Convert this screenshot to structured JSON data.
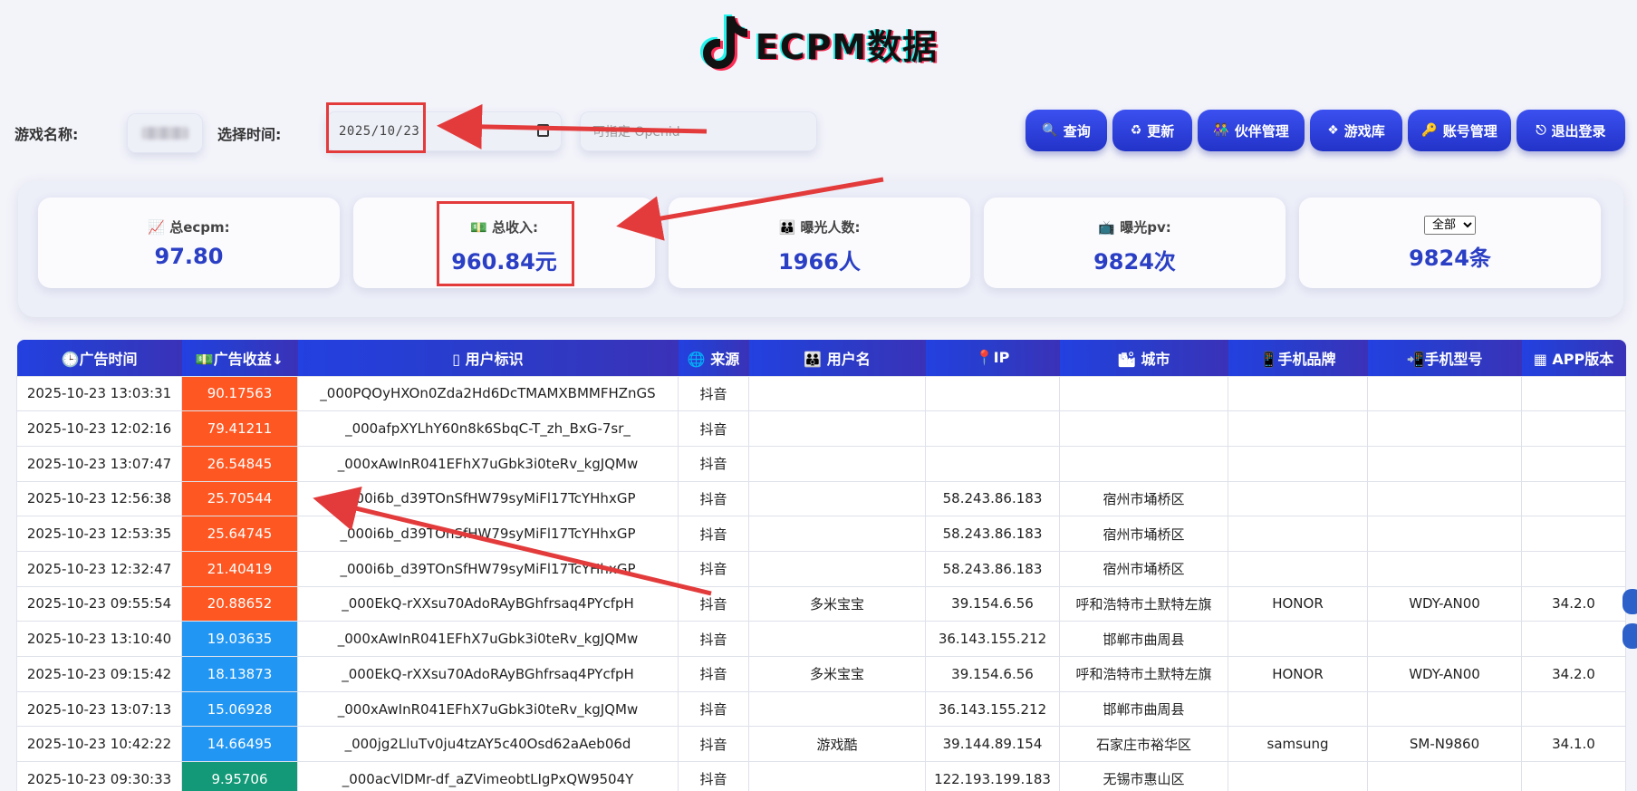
{
  "logo": {
    "text": "ECPM数据"
  },
  "filters": {
    "game_label": "游戏名称:",
    "time_label": "选择时间:",
    "date_value": "2025/10/23",
    "openid_placeholder": "可指定 Openid"
  },
  "toolbar": {
    "buttons": [
      {
        "label": "查询",
        "icon": "magnifier-icon"
      },
      {
        "label": "更新",
        "icon": "recycle-icon"
      },
      {
        "label": "伙伴管理",
        "icon": "people-icon"
      },
      {
        "label": "游戏库",
        "icon": "cube-icon"
      },
      {
        "label": "账号管理",
        "icon": "key-icon"
      },
      {
        "label": "退出登录",
        "icon": "logout-icon"
      }
    ]
  },
  "stats": [
    {
      "label": "总ecpm:",
      "value": "97.80",
      "icon": "chart-icon"
    },
    {
      "label": "总收入:",
      "value": "960.84元",
      "icon": "money-icon"
    },
    {
      "label": "曝光人数:",
      "value": "1966人",
      "icon": "people-icon"
    },
    {
      "label": "曝光pv:",
      "value": "9824次",
      "icon": "tv-icon"
    },
    {
      "label": "全部",
      "value": "9824条",
      "icon": "select"
    }
  ],
  "table": {
    "headers": [
      "广告时间",
      "广告收益↓",
      "用户标识",
      "来源",
      "用户名",
      "IP",
      "城市",
      "手机品牌",
      "手机型号",
      "APP版本"
    ],
    "rows": [
      [
        "2025-10-23 13:03:31",
        "90.17563",
        "_000PQOyHXOn0Zda2Hd6DcTMAMXBMMFHZnGS",
        "抖音",
        "",
        "",
        "",
        "",
        "",
        ""
      ],
      [
        "2025-10-23 12:02:16",
        "79.41211",
        "_000afpXYLhY60n8k6SbqC-T_zh_BxG-7sr_",
        "抖音",
        "",
        "",
        "",
        "",
        "",
        ""
      ],
      [
        "2025-10-23 13:07:47",
        "26.54845",
        "_000xAwInR041EFhX7uGbk3i0teRv_kgJQMw",
        "抖音",
        "",
        "",
        "",
        "",
        "",
        ""
      ],
      [
        "2025-10-23 12:56:38",
        "25.70544",
        "_000i6b_d39TOnSfHW79syMiFl17TcYHhxGP",
        "抖音",
        "",
        "58.243.86.183",
        "宿州市埇桥区",
        "",
        "",
        ""
      ],
      [
        "2025-10-23 12:53:35",
        "25.64745",
        "_000i6b_d39TOnSfHW79syMiFl17TcYHhxGP",
        "抖音",
        "",
        "58.243.86.183",
        "宿州市埇桥区",
        "",
        "",
        ""
      ],
      [
        "2025-10-23 12:32:47",
        "21.40419",
        "_000i6b_d39TOnSfHW79syMiFl17TcYHhxGP",
        "抖音",
        "",
        "58.243.86.183",
        "宿州市埇桥区",
        "",
        "",
        ""
      ],
      [
        "2025-10-23 09:55:54",
        "20.88652",
        "_000EkQ-rXXsu70AdoRAyBGhfrsaq4PYcfpH",
        "抖音",
        "多米宝宝",
        "39.154.6.56",
        "呼和浩特市土默特左旗",
        "HONOR",
        "WDY-AN00",
        "34.2.0"
      ],
      [
        "2025-10-23 13:10:40",
        "19.03635",
        "_000xAwInR041EFhX7uGbk3i0teRv_kgJQMw",
        "抖音",
        "",
        "36.143.155.212",
        "邯郸市曲周县",
        "",
        "",
        ""
      ],
      [
        "2025-10-23 09:15:42",
        "18.13873",
        "_000EkQ-rXXsu70AdoRAyBGhfrsaq4PYcfpH",
        "抖音",
        "多米宝宝",
        "39.154.6.56",
        "呼和浩特市土默特左旗",
        "HONOR",
        "WDY-AN00",
        "34.2.0"
      ],
      [
        "2025-10-23 13:07:13",
        "15.06928",
        "_000xAwInR041EFhX7uGbk3i0teRv_kgJQMw",
        "抖音",
        "",
        "36.143.155.212",
        "邯郸市曲周县",
        "",
        "",
        ""
      ],
      [
        "2025-10-23 10:42:22",
        "14.66495",
        "_000jg2LluTv0ju4tzAY5c40Osd62aAeb06d",
        "抖音",
        "游戏酷",
        "39.144.89.154",
        "石家庄市裕华区",
        "samsung",
        "SM-N9860",
        "34.1.0"
      ],
      [
        "2025-10-23 09:30:33",
        "9.95706",
        "_000acVlDMr-df_aZVimeobtLIgPxQW9504Y",
        "抖音",
        "",
        "122.193.199.183",
        "无锡市惠山区",
        "",
        "",
        ""
      ]
    ],
    "revenue_levels": [
      "hi",
      "hi",
      "hi",
      "hi",
      "hi",
      "hi",
      "hi",
      "mid",
      "mid",
      "mid",
      "mid",
      "lo"
    ]
  },
  "colors": {
    "accent": "#2a3fc4",
    "rev_hi": "#ff5722",
    "rev_mid": "#2196f3",
    "rev_lo": "#139977",
    "annotation": "#e33b3b"
  }
}
